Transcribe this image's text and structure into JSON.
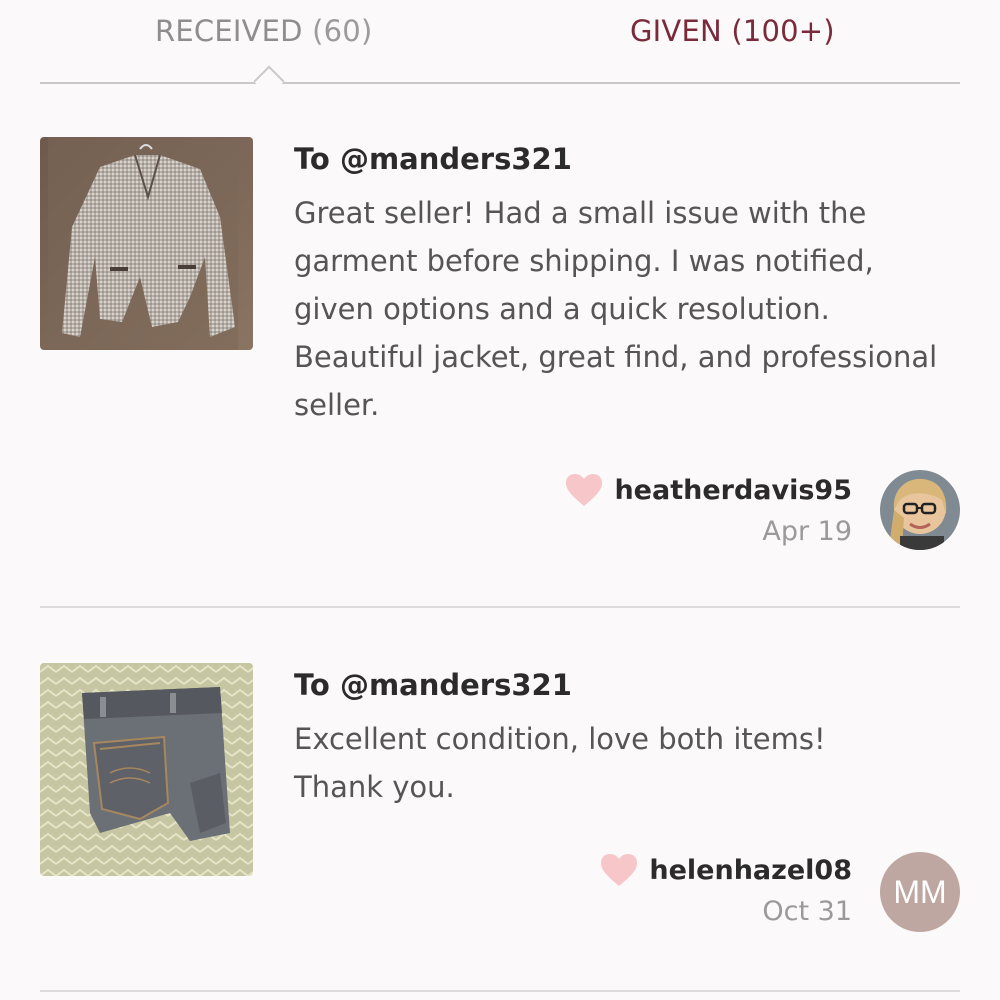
{
  "tabs": {
    "received": {
      "label": "RECEIVED",
      "count": "(60)"
    },
    "given": {
      "label": "GIVEN",
      "count": "(100+)"
    }
  },
  "reviews": [
    {
      "to": "To @manders321",
      "text": "Great seller! Had a small issue with the garment before shipping. I was notified, given options and a quick resolution. Beautiful jacket, great find, and professional seller.",
      "username": "heatherdavis95",
      "date": "Apr 19",
      "thumb_icon": "jacket-photo",
      "avatar_icon": "user-photo"
    },
    {
      "to": "To @manders321",
      "text": "Excellent condition, love both items! Thank you.",
      "username": "helenhazel08",
      "date": "Oct 31",
      "thumb_icon": "jeans-photo",
      "avatar_initials": "MM"
    }
  ],
  "colors": {
    "background": "#fbf9fa",
    "given_tab": "#7a2a3a",
    "heart": "#f7c6c9",
    "avatar_initials_bg": "#bfa7a1"
  }
}
